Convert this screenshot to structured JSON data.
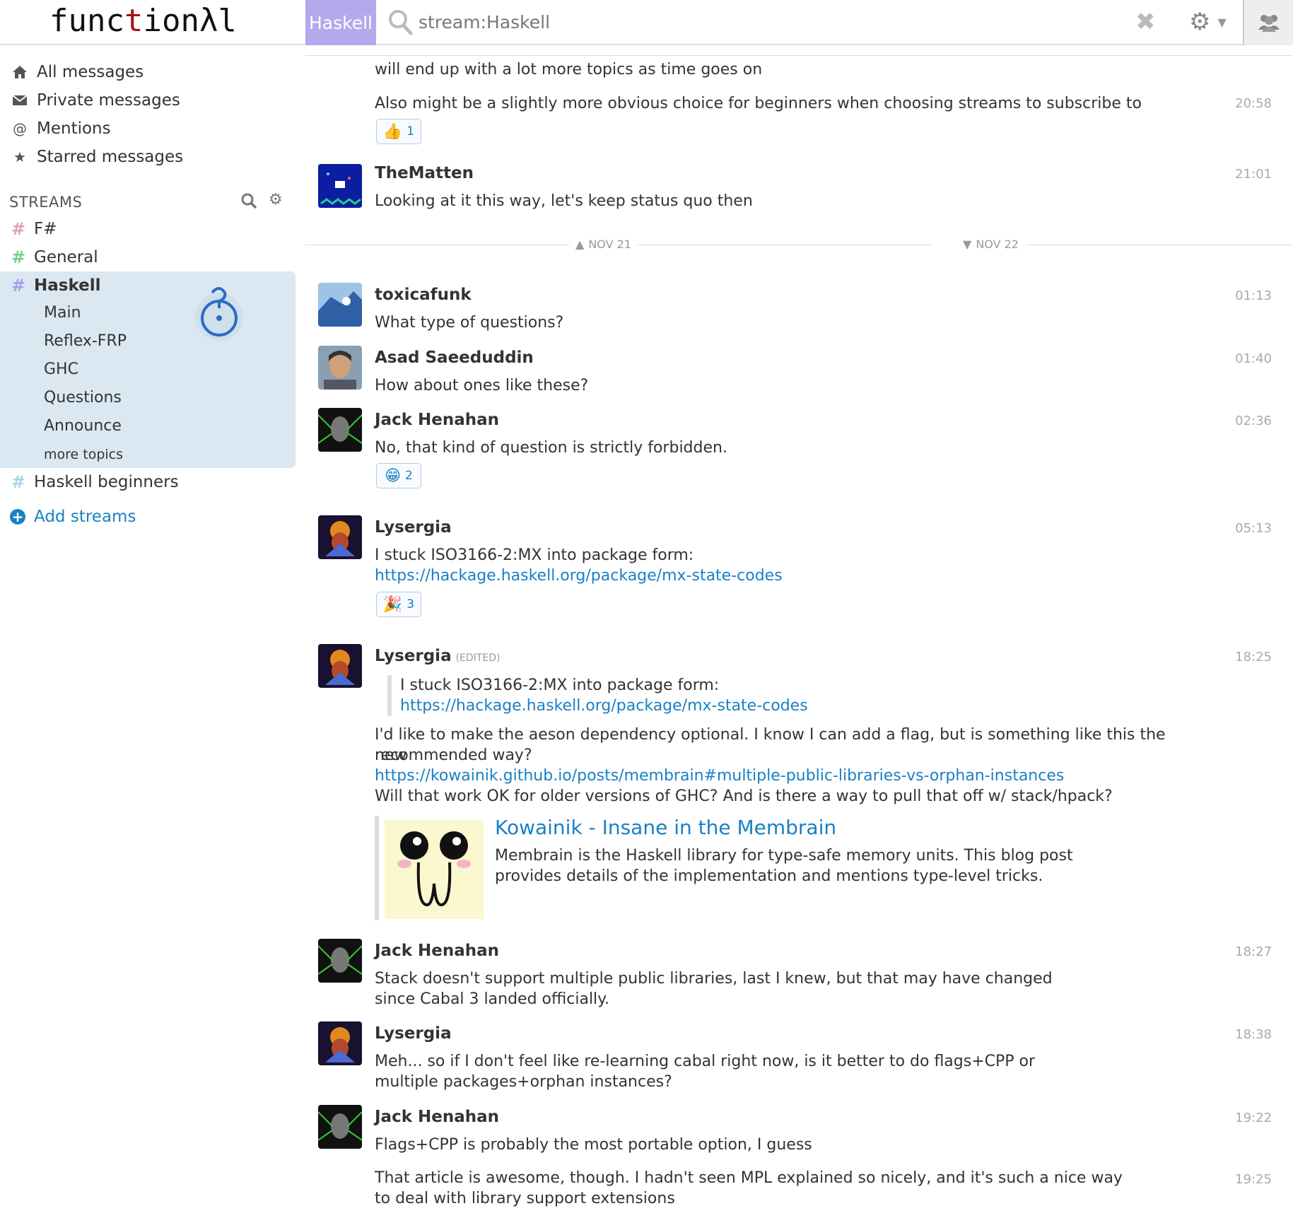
{
  "header": {
    "logo": {
      "part1": "func",
      "part2": "t",
      "part3": "io",
      "part4": "nλl"
    },
    "stream_tag": "Haskell",
    "search_value": "stream:Haskell"
  },
  "sidebar": {
    "nav": [
      {
        "label": "All messages",
        "icon": "home-icon"
      },
      {
        "label": "Private messages",
        "icon": "envelope-icon"
      },
      {
        "label": "Mentions",
        "icon": "at-icon"
      },
      {
        "label": "Starred messages",
        "icon": "star-icon"
      }
    ],
    "streams_heading": "STREAMS",
    "streams": [
      {
        "name": "F#",
        "color": "#e4a1b2"
      },
      {
        "name": "General",
        "color": "#76ce90"
      },
      {
        "name": "Haskell",
        "color": "#a99de6"
      },
      {
        "name": "Haskell beginners",
        "color": "#a3d8e0"
      }
    ],
    "topics": [
      "Main",
      "Reflex-FRP",
      "GHC",
      "Questions",
      "Announce"
    ],
    "more_topics": "more topics",
    "add_streams": "Add streams"
  },
  "divider": {
    "left": "NOV 21",
    "right": "NOV 22"
  },
  "messages": [
    {
      "text1": "will end up with a lot more topics as time goes on",
      "text2": "Also might be a slightly more obvious choice for beginners when choosing streams to subscribe to",
      "time": "20:58",
      "reaction_count": "1"
    },
    {
      "sender": "TheMatten",
      "time": "21:01",
      "text": "Looking at it this way, let's keep status quo then"
    },
    {
      "sender": "toxicafunk",
      "time": "01:13",
      "text": "What type of questions?"
    },
    {
      "sender": "Asad Saeeduddin",
      "time": "01:40",
      "text": "How about ones like these?"
    },
    {
      "sender": "Jack Henahan",
      "time": "02:36",
      "text": "No, that kind of question is strictly forbidden.",
      "reaction_count": "2"
    },
    {
      "sender": "Lysergia",
      "time": "05:13",
      "text": "I stuck ISO3166-2:MX into package form:",
      "link": "https://hackage.haskell.org/package/mx-state-codes",
      "reaction_count": "3"
    },
    {
      "sender": "Lysergia",
      "edited": "(EDITED)",
      "time": "18:25",
      "quote_text": "I stuck ISO3166-2:MX into package form:",
      "quote_link": "https://hackage.haskell.org/package/mx-state-codes",
      "text1": "I'd like to make the aeson dependency optional. I know I can add a flag, but is something like this the new",
      "text2": "recommended way?",
      "link": "https://kowainik.github.io/posts/membrain#multiple-public-libraries-vs-orphan-instances",
      "text3": "Will that work OK for older versions of GHC? And is there a way to pull that off w/ stack/hpack?",
      "preview_title": "Kowainik - Insane in the Membrain",
      "preview_desc": "Membrain is the Haskell library for type-safe memory units. This blog post provides details of the implementation and mentions type-level tricks."
    },
    {
      "sender": "Jack Henahan",
      "time": "18:27",
      "text": "Stack doesn't support multiple public libraries, last I knew, but that may have changed since Cabal 3 landed officially."
    },
    {
      "sender": "Lysergia",
      "time": "18:38",
      "text": "Meh... so if I don't feel like re-learning cabal right now, is it better to do flags+CPP or multiple packages+orphan instances?"
    },
    {
      "sender": "Jack Henahan",
      "time": "19:22",
      "text": "Flags+CPP is probably the most portable option, I guess"
    },
    {
      "time": "19:25",
      "text": "That article is awesome, though. I hadn't seen MPL explained so nicely, and it's such a nice way to deal with library support extensions"
    }
  ]
}
